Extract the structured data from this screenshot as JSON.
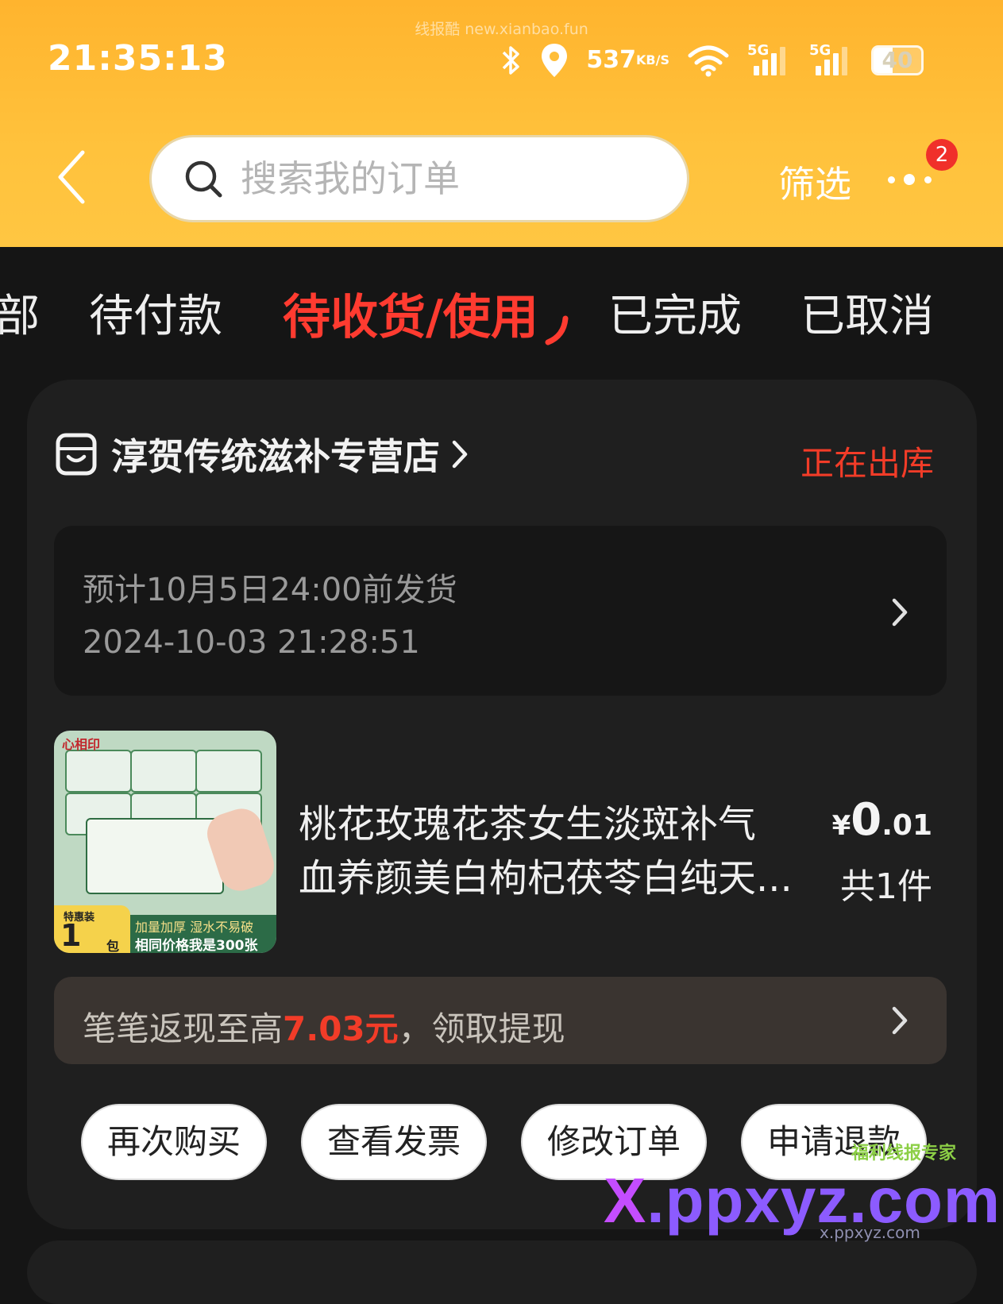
{
  "watermark": {
    "top": "线报酷 new.xianbao.fun",
    "logo_small": "福利线报专家",
    "logo_big_x": "X",
    "logo_big_rest": ".ppxyz.com",
    "logo_url": "x.ppxyz.com"
  },
  "status_bar": {
    "time": "21:35:13",
    "net_speed_value": "537",
    "net_speed_unit": "KB/S",
    "signal1_label": "5G",
    "signal2_label": "5G",
    "battery": "40",
    "battery_level": 0.4,
    "icons": [
      "bluetooth-icon",
      "location-icon",
      "wifi-icon"
    ]
  },
  "header": {
    "search_placeholder": "搜索我的订单",
    "filter_label": "筛选",
    "more_badge": "2"
  },
  "tabs": [
    {
      "label": "部",
      "active": false
    },
    {
      "label": "待付款",
      "active": false
    },
    {
      "label": "待收货/使用",
      "active": true
    },
    {
      "label": "已完成",
      "active": false
    },
    {
      "label": "已取消",
      "active": false
    }
  ],
  "order": {
    "shop_name": "淳贺传统滋补专营店",
    "status": "正在出库",
    "ship_estimate": "预计10月5日24:00前发货",
    "order_time": "2024-10-03 21:28:51",
    "product": {
      "title_line1": "桃花玫瑰花茶女生淡斑补气",
      "title_line2": "血养颜美白枸杞茯苓白纯天...",
      "price_currency": "¥",
      "price_int": "0",
      "price_dec": ".01",
      "quantity": "共1件",
      "image": {
        "brand": "心相印",
        "badge_top": "特惠装",
        "badge_num": "1",
        "badge_unit": "包",
        "slogan1": "加量加厚 湿水不易破",
        "slogan2": "相同价格我是300张"
      }
    },
    "cashback": {
      "prefix": "笔笔返现至高",
      "amount": "7.03元",
      "suffix": "，领取提现"
    },
    "actions": [
      "再次购买",
      "查看发票",
      "修改订单",
      "申请退款"
    ]
  },
  "colors": {
    "header_gradient_top": "#ffb42e",
    "header_gradient_bottom": "#ffc642",
    "active_tab": "#ff3b30",
    "status_red": "#f23c28",
    "background": "#151515",
    "card": "#1f1f1f"
  }
}
